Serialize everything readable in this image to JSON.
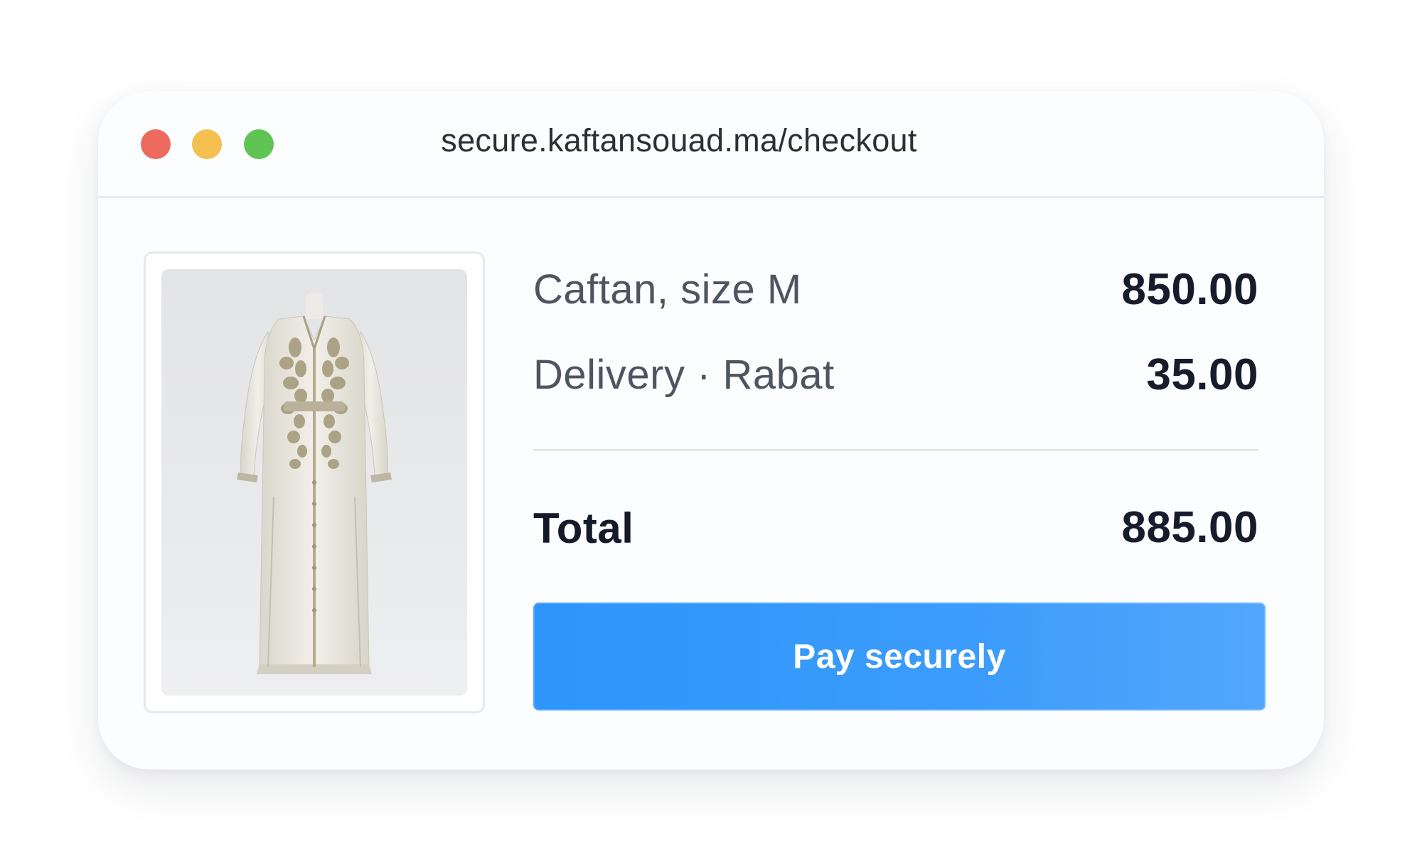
{
  "browser": {
    "url": "secure.kaftansouad.ma/checkout",
    "window_controls": [
      "close",
      "minimize",
      "zoom"
    ],
    "colors": {
      "close": "#ec6a5e",
      "minimize": "#f4c04f",
      "zoom": "#5fc454"
    }
  },
  "product": {
    "image_icon": "product-photo-caftan"
  },
  "order": {
    "items": [
      {
        "label": "Caftan, size M",
        "amount": "850.00"
      },
      {
        "label": "Delivery · Rabat",
        "amount": "35.00"
      }
    ],
    "total": {
      "label": "Total",
      "amount": "885.00"
    }
  },
  "actions": {
    "pay_label": "Pay securely",
    "pay_color": "#2d95fb"
  }
}
